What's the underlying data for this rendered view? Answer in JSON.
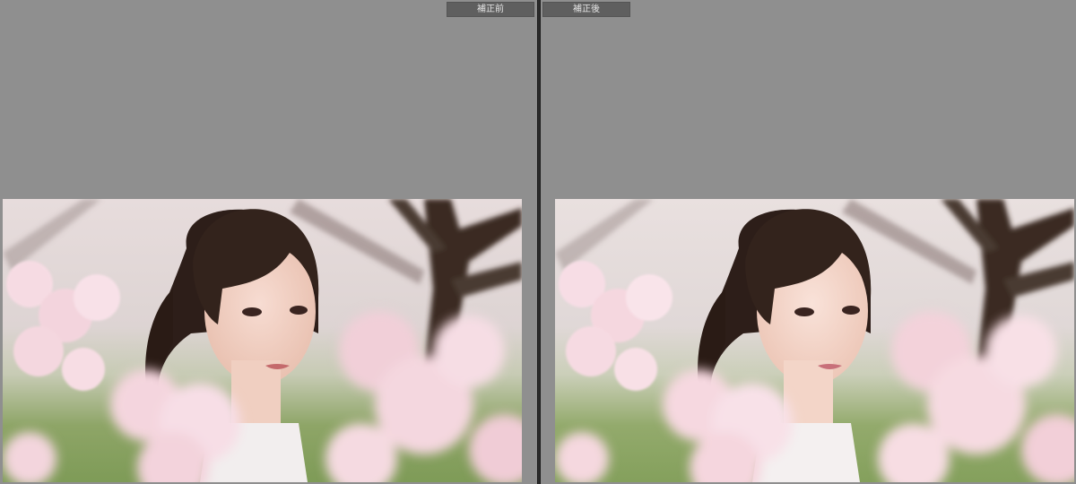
{
  "views": {
    "before": {
      "label": "補正前"
    },
    "after": {
      "label": "補正後"
    }
  },
  "photo": {
    "subject": "portrait-woman-cherry-blossoms"
  },
  "colors": {
    "workspace": "#8f8f8f",
    "label_bg": "#5f5f5f",
    "label_text": "#e6e6e6",
    "divider": "#1c1c1c"
  }
}
